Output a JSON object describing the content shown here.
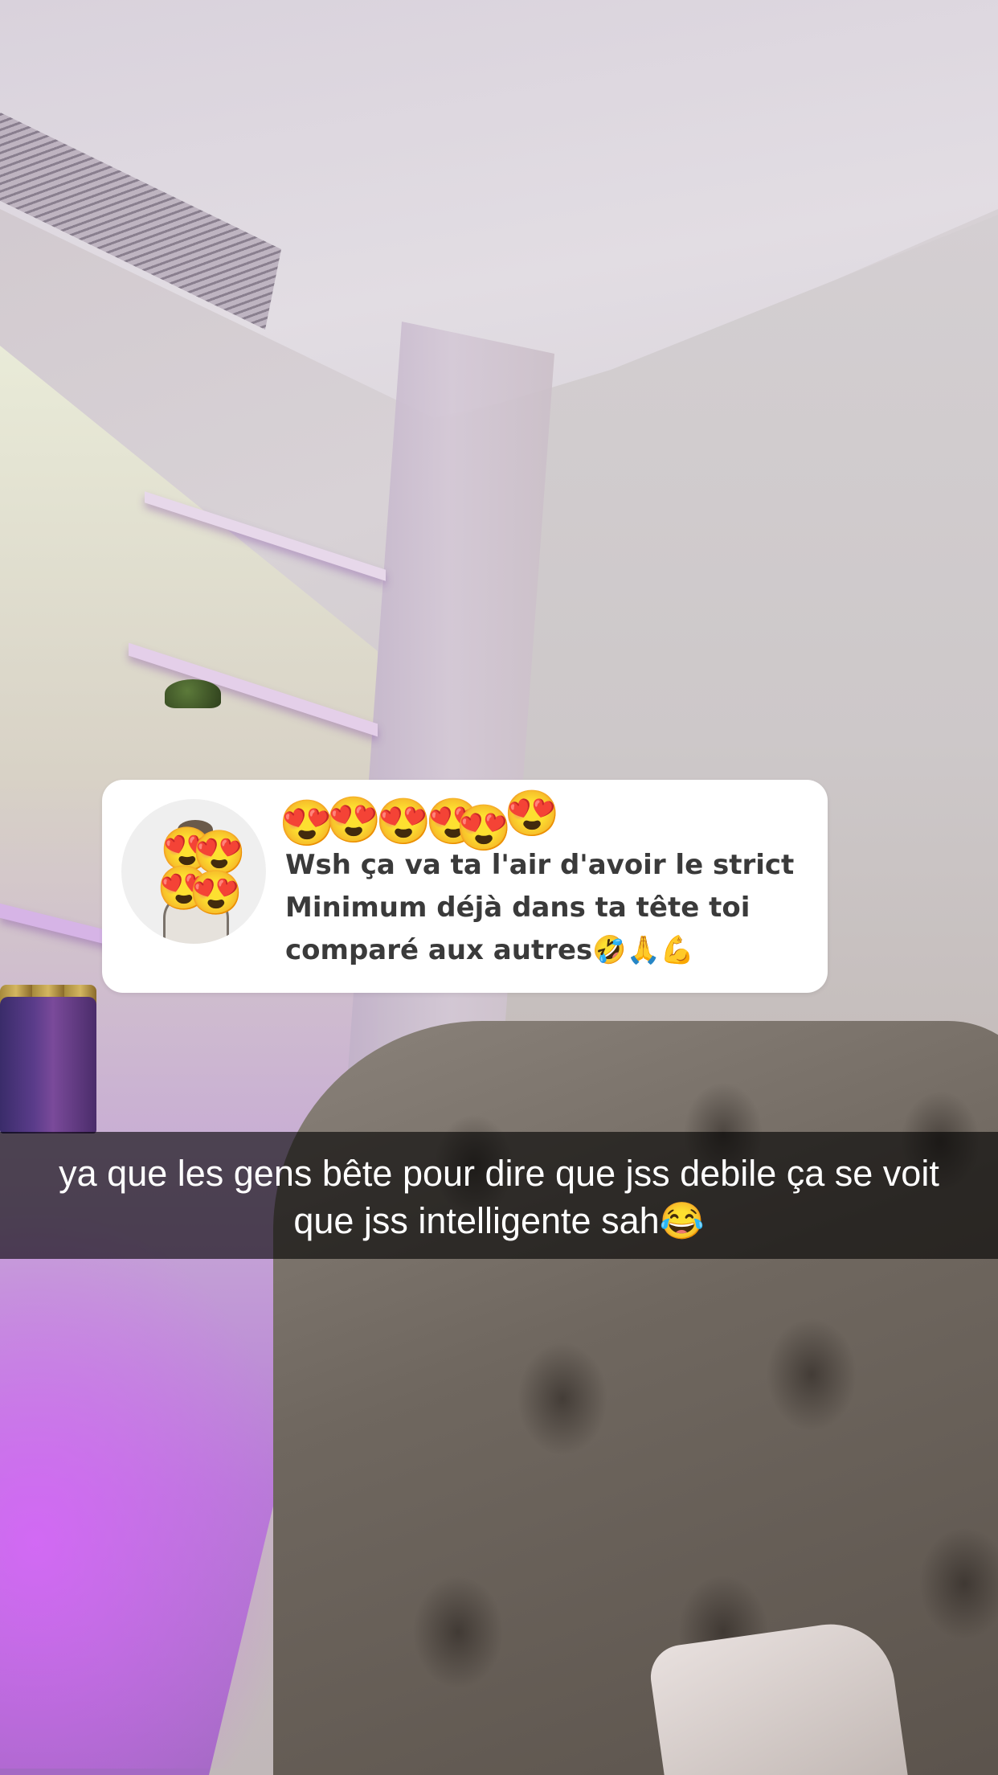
{
  "question_sticker": {
    "avatar_emojis": [
      "😍",
      "😍",
      "😍",
      "😍"
    ],
    "emoji_row": [
      "😍",
      "😍",
      "😍",
      "😍",
      "😍",
      "😍"
    ],
    "question": "Wsh ça va ta l'air d'avoir le strict\nMinimum déjà  dans ta tête toi\ncomparé aux autres🤣🙏💪"
  },
  "caption": {
    "text": "ya que les gens bête pour dire que jss debile ça se voit que jss intelligente sah😂"
  },
  "colors": {
    "sticker_background": "#ffffff",
    "question_text": "#3a3a3a",
    "caption_text": "#ffffff",
    "caption_bar": "rgba(0,0,0,0.62)"
  },
  "icons": {
    "avatar": "bitmoji-avatar-icon"
  }
}
